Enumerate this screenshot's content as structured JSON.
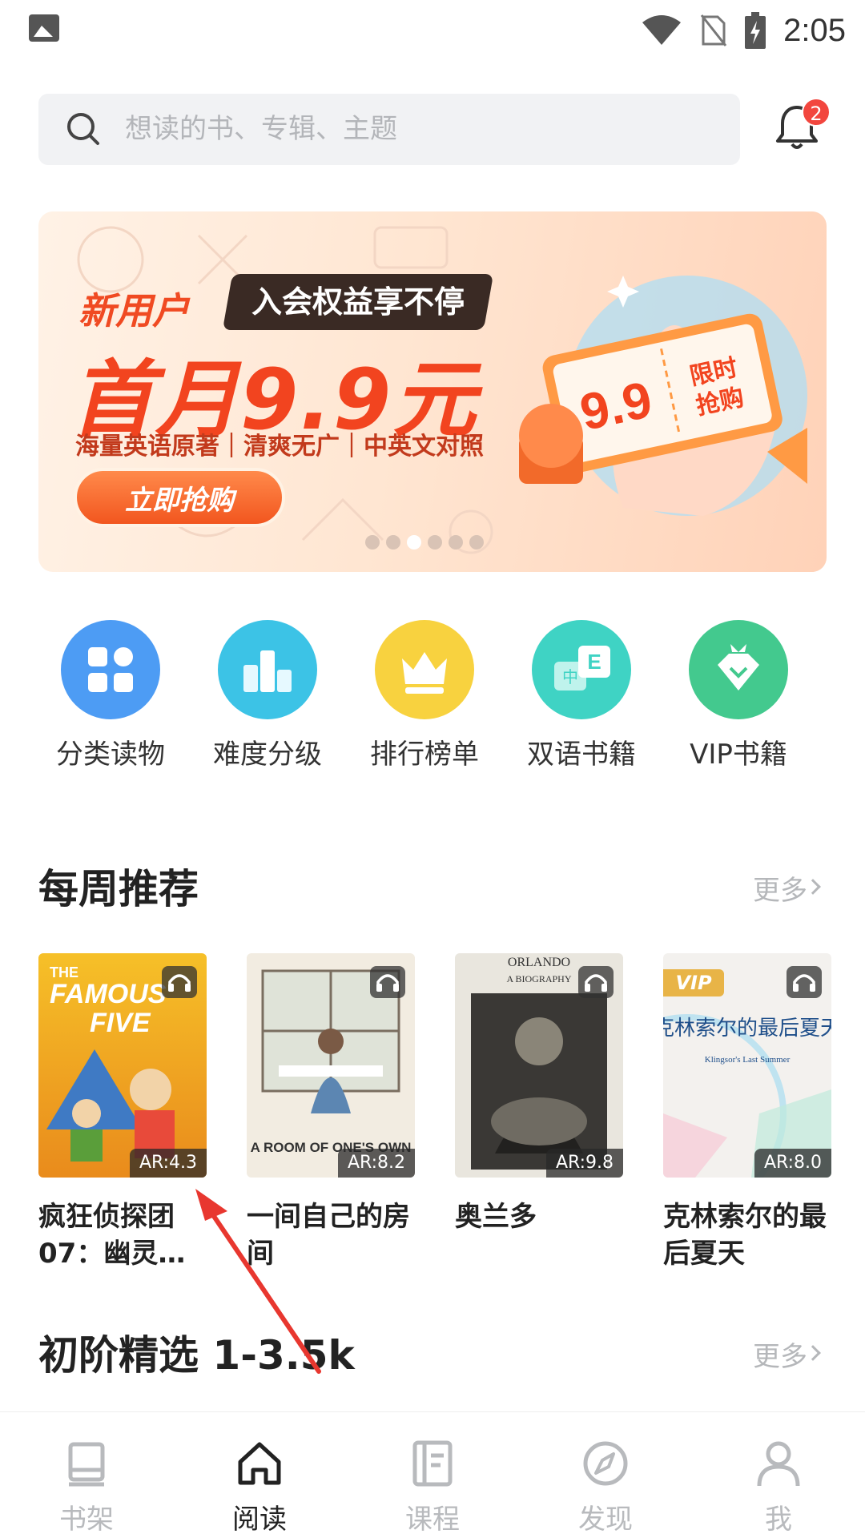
{
  "status_bar": {
    "time": "2:05"
  },
  "search": {
    "placeholder": "想读的书、专辑、主题",
    "notification_count": "2"
  },
  "banner": {
    "line1": "新用户",
    "tag": "入会权益享不停",
    "headline": "首月9.9元",
    "subline": "海量英语原著｜清爽无广｜中英文对照",
    "button": "立即抢购",
    "ticket_price": "9.9",
    "ticket_label": "限时抢购",
    "dots": 6,
    "active_dot": 2
  },
  "quick_menu": [
    {
      "label": "分类读物",
      "icon": "category-icon",
      "color": "#4d9cf4"
    },
    {
      "label": "难度分级",
      "icon": "level-icon",
      "color": "#3cc3e6"
    },
    {
      "label": "排行榜单",
      "icon": "crown-icon",
      "color": "#f8d23f"
    },
    {
      "label": "双语书籍",
      "icon": "bilingual-icon",
      "color": "#3fd3c4"
    },
    {
      "label": "VIP书籍",
      "icon": "vip-diamond-icon",
      "color": "#43c98e"
    }
  ],
  "weekly": {
    "title": "每周推荐",
    "more": "更多",
    "books": [
      {
        "title": "疯狂侦探团07：幽灵…",
        "ar": "AR:4.3",
        "vip": false,
        "cover_text": "THE FAMOUS FIVE"
      },
      {
        "title": "一间自己的房间",
        "ar": "AR:8.2",
        "vip": false,
        "cover_text": "A ROOM OF ONE'S OWN"
      },
      {
        "title": "奥兰多",
        "ar": "AR:9.8",
        "vip": false,
        "cover_text": "ORLANDO"
      },
      {
        "title": "克林索尔的最后夏天",
        "ar": "AR:8.0",
        "vip": true,
        "vip_label": "VIP",
        "cover_text": "克林索尔的最后夏天",
        "cover_subtext": "Klingsor's Last Summer"
      }
    ]
  },
  "beginner": {
    "title": "初阶精选 1-3.5k",
    "more": "更多"
  },
  "bottom_nav": [
    {
      "label": "书架",
      "icon": "bookshelf-icon",
      "active": false
    },
    {
      "label": "阅读",
      "icon": "home-read-icon",
      "active": true
    },
    {
      "label": "课程",
      "icon": "course-icon",
      "active": false
    },
    {
      "label": "发现",
      "icon": "compass-icon",
      "active": false
    },
    {
      "label": "我",
      "icon": "profile-icon",
      "active": false
    }
  ]
}
